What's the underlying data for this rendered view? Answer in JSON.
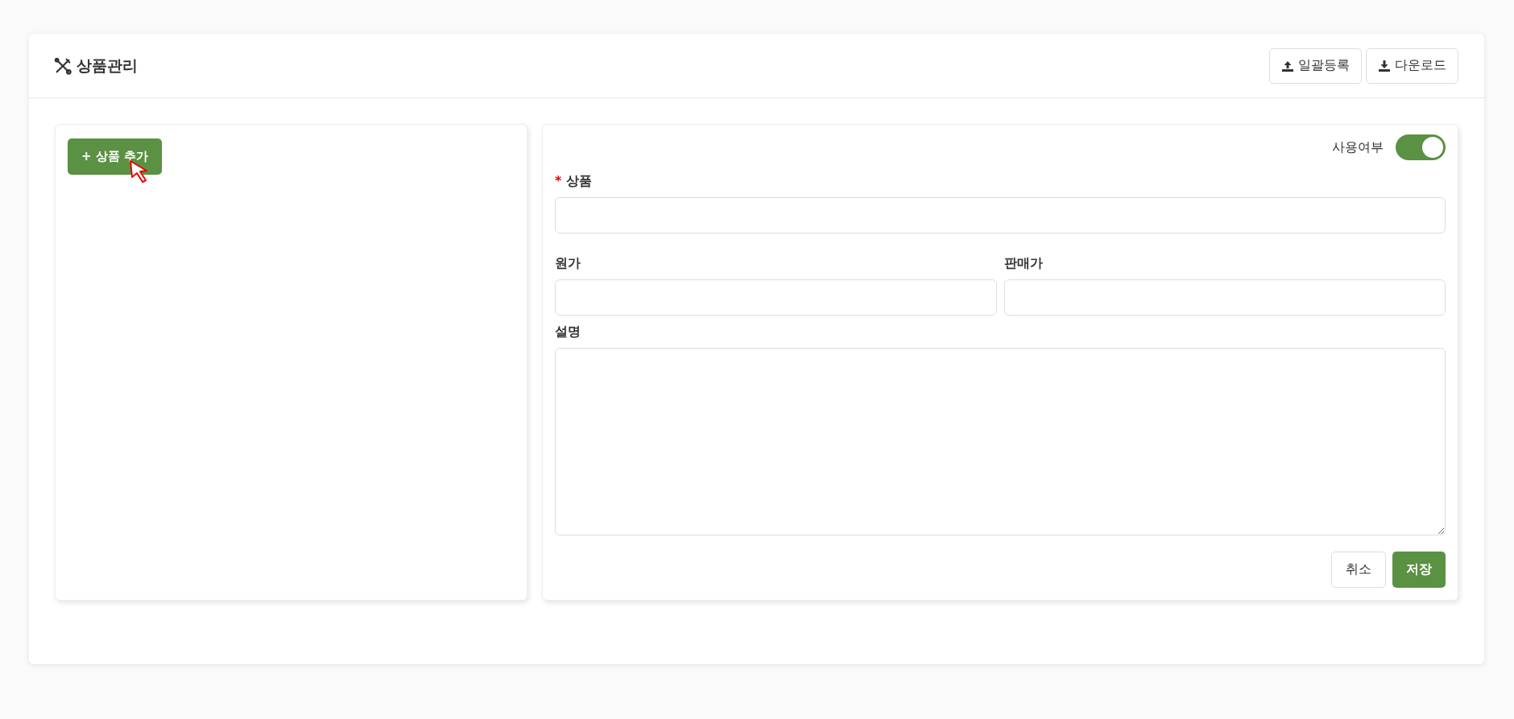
{
  "header": {
    "title": "상품관리",
    "buttons": [
      {
        "kind": "upload",
        "label": "일괄등록"
      },
      {
        "kind": "download",
        "label": "다운로드"
      }
    ]
  },
  "left_panel": {
    "add_button": "+ 상품 추가"
  },
  "form": {
    "use_toggle": {
      "label": "사용여부",
      "on": true
    },
    "fields": [
      {
        "label": "상품",
        "required_mark": "*",
        "kind": "input"
      },
      {
        "label": "원가",
        "kind": "input"
      },
      {
        "label": "판매가",
        "kind": "input"
      },
      {
        "label": "설명",
        "kind": "textarea"
      }
    ],
    "buttons": [
      {
        "label": "취소",
        "primary": false
      },
      {
        "label": "저장",
        "primary": true
      }
    ]
  }
}
